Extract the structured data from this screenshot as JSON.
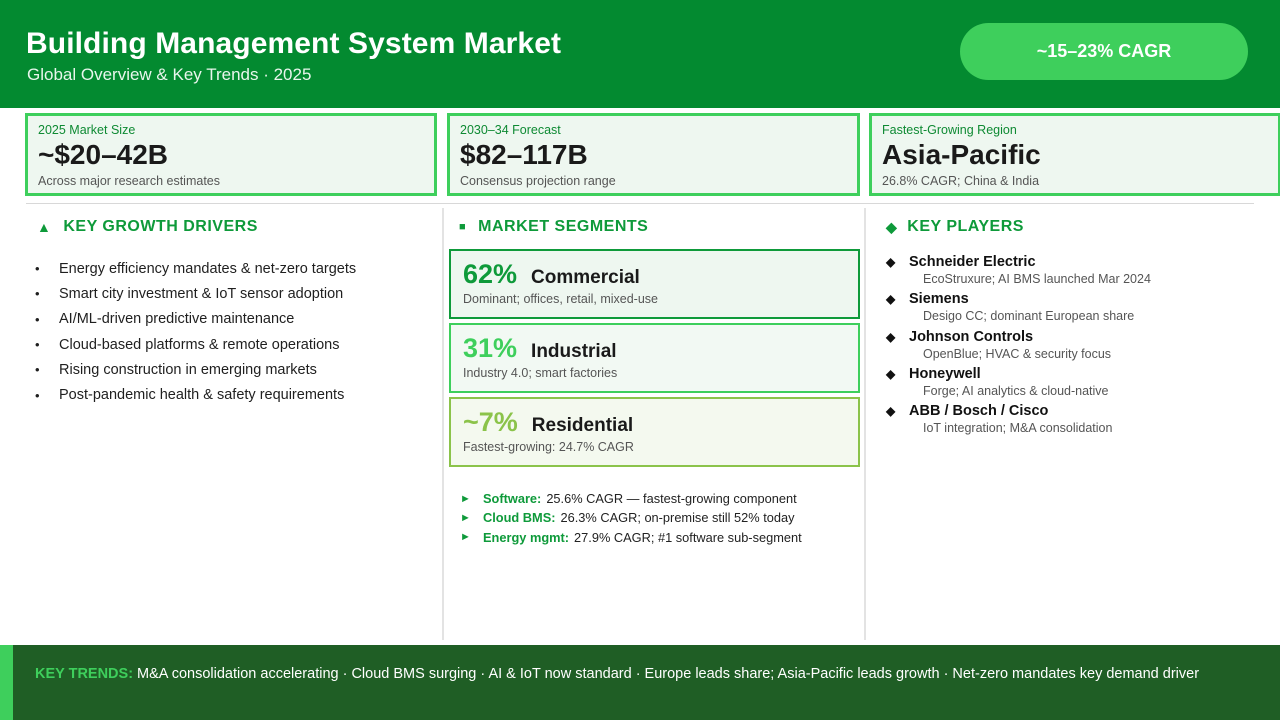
{
  "header": {
    "title": "Building Management System Market",
    "subtitle": "Global Overview & Key Trends  ·  2025",
    "cagr_badge": "~15–23% CAGR"
  },
  "stats": [
    {
      "label": "2025 Market Size",
      "value": "~$20–42B",
      "note": "Across major research estimates"
    },
    {
      "label": "2030–34 Forecast",
      "value": "$82–117B",
      "note": "Consensus projection range"
    },
    {
      "label": "Fastest-Growing Region",
      "value": "Asia-Pacific",
      "note": "26.8% CAGR; China & India"
    }
  ],
  "drivers": {
    "icon": "triangle-up-icon",
    "heading": "KEY GROWTH DRIVERS",
    "bullet": "•",
    "items": [
      "Energy efficiency mandates & net-zero targets",
      "Smart city investment & IoT sensor adoption",
      "AI/ML-driven predictive maintenance",
      "Cloud-based platforms & remote operations",
      "Rising construction in emerging markets",
      "Post-pandemic health & safety requirements"
    ]
  },
  "segments": {
    "icon": "square-icon",
    "heading": "MARKET SEGMENTS",
    "items": [
      {
        "pct": "62%",
        "name": "Commercial",
        "desc": "Dominant; offices, retail, mixed-use",
        "color": "#0e9a3a"
      },
      {
        "pct": "31%",
        "name": "Industrial",
        "desc": "Industry 4.0; smart factories",
        "color": "#3ecf5c"
      },
      {
        "pct": "~7%",
        "name": "Residential",
        "desc": "Fastest-growing: 24.7% CAGR",
        "color": "#8bc34a"
      }
    ],
    "extras": [
      {
        "key": "Software:",
        "text": "25.6% CAGR — fastest-growing component"
      },
      {
        "key": "Cloud BMS:",
        "text": "26.3% CAGR; on-premise still 52% today"
      },
      {
        "key": "Energy mgmt:",
        "text": "27.9% CAGR; #1 software sub-segment"
      }
    ]
  },
  "players": {
    "icon": "diamond-icon",
    "heading": "KEY PLAYERS",
    "items": [
      {
        "name": "Schneider Electric",
        "desc": "EcoStruxure; AI BMS launched Mar 2024"
      },
      {
        "name": "Siemens",
        "desc": "Desigo CC; dominant European share"
      },
      {
        "name": "Johnson Controls",
        "desc": "OpenBlue; HVAC & security focus"
      },
      {
        "name": "Honeywell",
        "desc": "Forge; AI analytics & cloud-native"
      },
      {
        "name": "ABB / Bosch / Cisco",
        "desc": "IoT integration; M&A consolidation"
      }
    ]
  },
  "footer": {
    "label": "KEY TRENDS:",
    "text": " M&A consolidation accelerating  ·  Cloud BMS surging  ·  AI & IoT now standard  ·  Europe leads share; Asia-Pacific leads growth  ·  Net-zero mandates key demand driver"
  },
  "colors": {
    "header_green": "#038a30",
    "accent_green": "#3ecf5c",
    "footer_green": "#1f5e25",
    "heading_green": "#0e9a3a"
  }
}
